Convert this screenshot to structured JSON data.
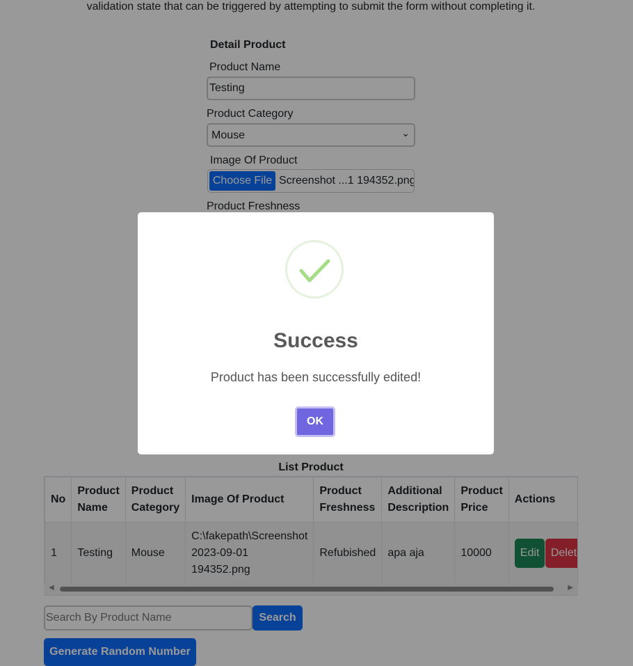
{
  "intro_text": "validation state that can be triggered by attempting to submit the form without completing it.",
  "form": {
    "title": "Detail Product",
    "product_name_label": "Product Name",
    "product_name_value": "Testing",
    "category_label": "Product Category",
    "category_value": "Mouse",
    "image_label": "Image Of Product",
    "choose_file_label": "Choose File",
    "file_name": "Screenshot ...1 194352.png",
    "freshness_label": "Product Freshness"
  },
  "list": {
    "title": "List Product",
    "headers": [
      "No",
      "Product Name",
      "Product Category",
      "Image Of Product",
      "Product Freshness",
      "Additional Description",
      "Product Price",
      "Actions"
    ],
    "rows": [
      {
        "no": "1",
        "name": "Testing",
        "category": "Mouse",
        "image": "C:\\fakepath\\Screenshot 2023-09-01 194352.png",
        "freshness": "Refubished",
        "description": "apa aja",
        "price": "10000",
        "edit_label": "Edit",
        "delete_label": "Delete"
      }
    ]
  },
  "search": {
    "placeholder": "Search By Product Name",
    "button_label": "Search"
  },
  "generate_button_label": "Generate Random Number",
  "modal": {
    "icon": "success-check-icon",
    "title": "Success",
    "message": "Product has been successfully edited!",
    "ok_label": "OK"
  },
  "colors": {
    "primary": "#0d6efd",
    "success": "#198754",
    "danger": "#dc3545",
    "modal_confirm": "#7066e0",
    "check": "#a5dc86"
  }
}
